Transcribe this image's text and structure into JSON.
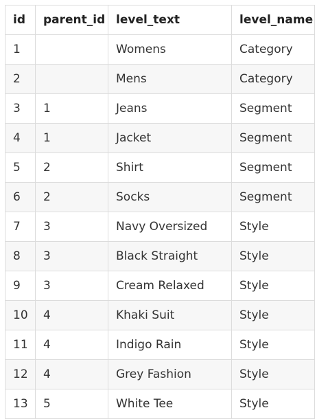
{
  "table": {
    "headers": [
      "id",
      "parent_id",
      "level_text",
      "level_name"
    ],
    "rows": [
      [
        "1",
        "",
        "Womens",
        "Category"
      ],
      [
        "2",
        "",
        "Mens",
        "Category"
      ],
      [
        "3",
        "1",
        "Jeans",
        "Segment"
      ],
      [
        "4",
        "1",
        "Jacket",
        "Segment"
      ],
      [
        "5",
        "2",
        "Shirt",
        "Segment"
      ],
      [
        "6",
        "2",
        "Socks",
        "Segment"
      ],
      [
        "7",
        "3",
        "Navy Oversized",
        "Style"
      ],
      [
        "8",
        "3",
        "Black Straight",
        "Style"
      ],
      [
        "9",
        "3",
        "Cream Relaxed",
        "Style"
      ],
      [
        "10",
        "4",
        "Khaki Suit",
        "Style"
      ],
      [
        "11",
        "4",
        "Indigo Rain",
        "Style"
      ],
      [
        "12",
        "4",
        "Grey Fashion",
        "Style"
      ],
      [
        "13",
        "5",
        "White Tee",
        "Style"
      ]
    ]
  }
}
